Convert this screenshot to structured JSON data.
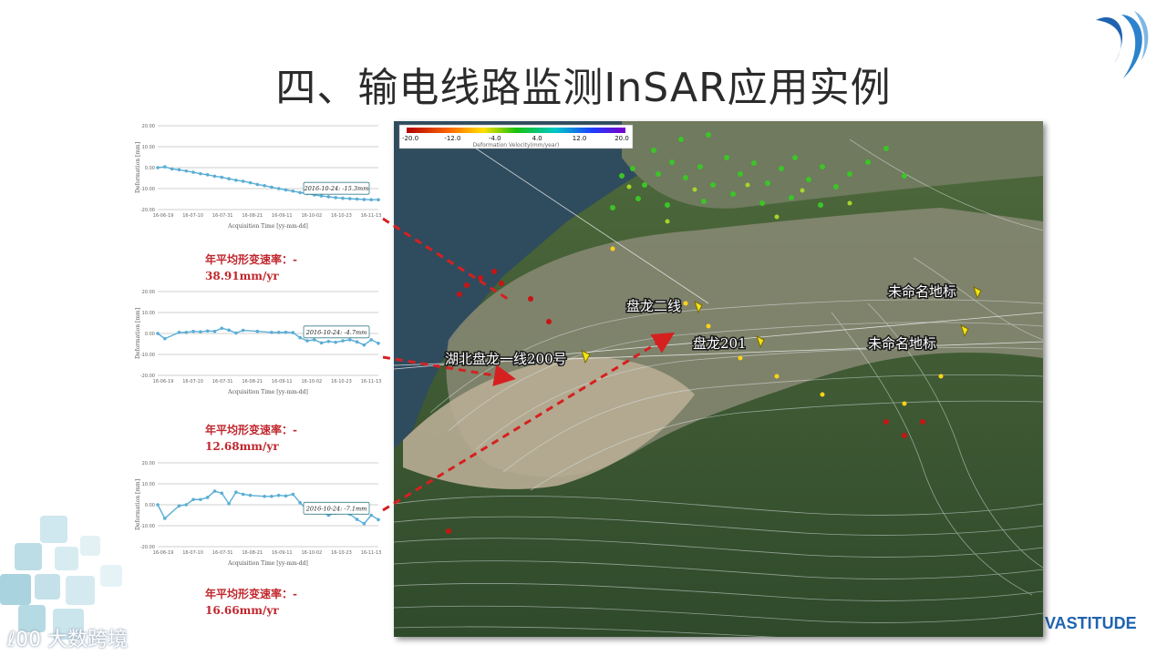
{
  "slide": {
    "title": "四、输电线路监测InSAR应用实例",
    "brand": "VASTITUDE",
    "watermark": "大数跨境",
    "accent_color": "#1f63b0"
  },
  "map": {
    "legend": {
      "title": "Deformation Velocity(mm/year)",
      "ticks": [
        "-20.0",
        "-12.0",
        "-4.0",
        "4.0",
        "12.0",
        "20.0"
      ]
    },
    "labels": [
      "盘龙二线",
      "盘龙201",
      "湖北盘龙一线200号",
      "未命名地标",
      "未命名地标"
    ]
  },
  "rate_labels": [
    {
      "text": "年平均形变速率：-",
      "value": "38.91mm/yr"
    },
    {
      "text": "年平均形变速率：-",
      "value": "12.68mm/yr"
    },
    {
      "text": "年平均形变速率：-",
      "value": "16.66mm/yr"
    }
  ],
  "chart_data": [
    {
      "type": "line",
      "ylabel": "Deformation [mm]",
      "xlabel": "Acquisition Time [yy-mm-dd]",
      "ylim": [
        -20,
        20
      ],
      "yticks": [
        "20.00",
        "10.00",
        "0.00",
        "-10.00",
        "-20.00"
      ],
      "xticks": [
        "16-06-19",
        "16-07-10",
        "16-07-31",
        "16-08-21",
        "16-09-11",
        "16-10-02",
        "16-10-23",
        "16-11-13"
      ],
      "x": [
        0,
        3,
        6,
        9,
        12,
        15,
        18,
        21,
        24,
        27,
        30,
        33,
        36,
        39,
        42,
        45,
        48,
        51,
        54,
        57,
        60,
        63,
        66,
        69,
        72,
        75,
        78,
        81,
        84,
        87,
        90,
        93
      ],
      "values": [
        0.0,
        0.4,
        -0.6,
        -1.0,
        -1.6,
        -2.2,
        -2.9,
        -3.4,
        -4.1,
        -4.6,
        -5.3,
        -6.0,
        -6.5,
        -7.2,
        -8.0,
        -8.6,
        -9.3,
        -10.0,
        -10.6,
        -11.2,
        -11.9,
        -12.4,
        -13.0,
        -13.5,
        -13.9,
        -14.3,
        -14.6,
        -14.8,
        -15.0,
        -15.2,
        -15.3,
        -15.3
      ],
      "annotation": "2016-10-24: -15.3mm",
      "color": "#5aaed6"
    },
    {
      "type": "line",
      "ylabel": "Deformation [mm]",
      "xlabel": "Acquisition Time [yy-mm-dd]",
      "ylim": [
        -20,
        20
      ],
      "yticks": [
        "20.00",
        "10.00",
        "0.00",
        "-10.00",
        "-20.00"
      ],
      "xticks": [
        "16-06-19",
        "16-07-10",
        "16-07-31",
        "16-08-21",
        "16-09-11",
        "16-10-02",
        "16-10-23",
        "16-11-13"
      ],
      "x": [
        0,
        3,
        9,
        12,
        15,
        18,
        21,
        24,
        27,
        30,
        33,
        36,
        42,
        48,
        51,
        54,
        57,
        60,
        63,
        66,
        69,
        72,
        75,
        78,
        81,
        84,
        87,
        90,
        93
      ],
      "values": [
        0.0,
        -2.5,
        0.5,
        0.5,
        1.0,
        0.8,
        1.2,
        1.0,
        2.5,
        1.6,
        0.2,
        1.5,
        1.0,
        0.5,
        0.5,
        0.6,
        0.4,
        -2.0,
        -3.5,
        -3.0,
        -4.5,
        -3.8,
        -4.2,
        -3.5,
        -3.0,
        -4.0,
        -5.5,
        -3.0,
        -4.7
      ],
      "annotation": "2016-10-24: -4.7mm",
      "color": "#5aaed6"
    },
    {
      "type": "line",
      "ylabel": "Deformation [mm]",
      "xlabel": "Acquisition Time [yy-mm-dd]",
      "ylim": [
        -20,
        20
      ],
      "yticks": [
        "20.00",
        "10.00",
        "0.00",
        "-10.00",
        "-20.00"
      ],
      "xticks": [
        "16-06-19",
        "16-07-10",
        "16-07-31",
        "16-08-21",
        "16-09-11",
        "16-10-02",
        "16-10-23",
        "16-11-13"
      ],
      "x": [
        0,
        3,
        9,
        12,
        15,
        18,
        21,
        24,
        27,
        30,
        33,
        36,
        39,
        45,
        48,
        51,
        54,
        57,
        60,
        63,
        66,
        69,
        72,
        75,
        78,
        81,
        84,
        87,
        90,
        93
      ],
      "values": [
        0.0,
        -6.5,
        -0.5,
        0.0,
        2.5,
        2.5,
        3.5,
        6.5,
        5.5,
        0.5,
        6.0,
        5.0,
        4.5,
        4.0,
        4.0,
        4.5,
        4.2,
        5.0,
        1.0,
        -2.5,
        -1.5,
        -3.5,
        -5.0,
        -4.0,
        -3.8,
        -4.5,
        -7.0,
        -9.0,
        -5.0,
        -7.1
      ],
      "annotation": "2016-10-24: -7.1mm",
      "color": "#5aaed6"
    }
  ]
}
